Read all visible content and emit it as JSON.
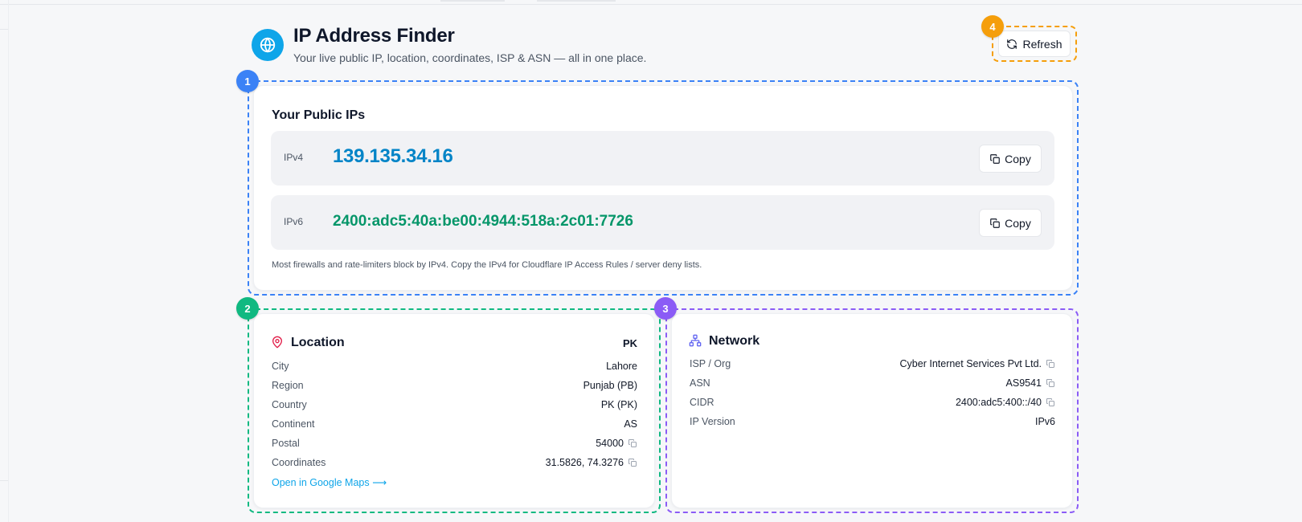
{
  "colors": {
    "accent": "#0ea5e9",
    "ipv4": "#0284c7",
    "ipv6": "#059669",
    "callout_1": "#3b82f6",
    "callout_2": "#10b981",
    "callout_3": "#8b5cf6",
    "callout_4": "#f59e0b",
    "location_icon": "#e11d48",
    "network_icon": "#6366f1"
  },
  "header": {
    "icon": "globe-icon",
    "title": "IP Address Finder",
    "subtitle": "Your live public IP, location, coordinates, ISP & ASN — all in one place.",
    "refresh_label": "Refresh",
    "refresh_icon": "refresh-icon"
  },
  "callouts": [
    "1",
    "2",
    "3",
    "4"
  ],
  "public_ips": {
    "title": "Your Public IPs",
    "rows": [
      {
        "label": "IPv4",
        "value": "139.135.34.16",
        "copy_label": "Copy"
      },
      {
        "label": "IPv6",
        "value": "2400:adc5:40a:be00:4944:518a:2c01:7726",
        "copy_label": "Copy"
      }
    ],
    "note": "Most firewalls and rate-limiters block by IPv4. Copy the IPv4 for Cloudflare IP Access Rules / server deny lists."
  },
  "location": {
    "icon": "map-pin-icon",
    "title": "Location",
    "country_code": "PK",
    "rows": [
      {
        "label": "City",
        "value": "Lahore"
      },
      {
        "label": "Region",
        "value": "Punjab (PB)"
      },
      {
        "label": "Country",
        "value": "PK (PK)"
      },
      {
        "label": "Continent",
        "value": "AS"
      },
      {
        "label": "Postal",
        "value": "54000"
      },
      {
        "label": "Coordinates",
        "value": "31.5826, 74.3276"
      }
    ],
    "maps_link": "Open in Google Maps ⟶"
  },
  "network": {
    "icon": "network-icon",
    "title": "Network",
    "rows": [
      {
        "label": "ISP / Org",
        "value": "Cyber Internet Services Pvt Ltd."
      },
      {
        "label": "ASN",
        "value": "AS9541"
      },
      {
        "label": "CIDR",
        "value": "2400:adc5:400::/40"
      },
      {
        "label": "IP Version",
        "value": "IPv6"
      }
    ]
  }
}
